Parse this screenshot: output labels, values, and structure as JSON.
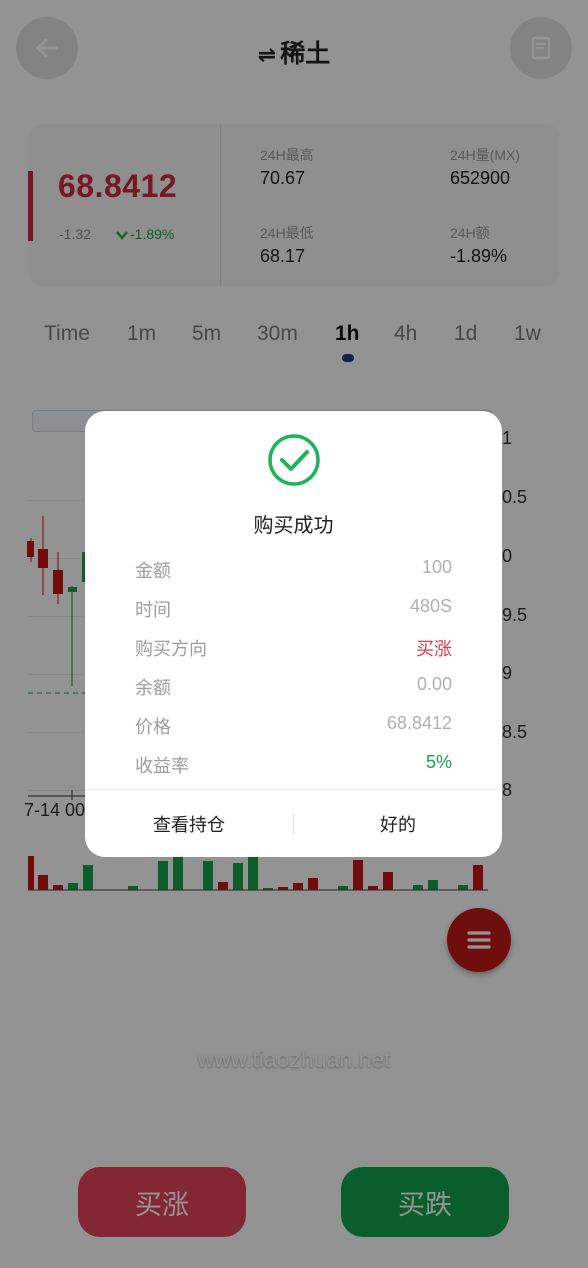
{
  "header": {
    "title": "稀土",
    "swap_glyph": "⇌",
    "back_icon": "arrow-left-icon",
    "doc_icon": "document-icon"
  },
  "ticker": {
    "price": "68.8412",
    "change": "-1.32",
    "change_pct": "-1.89%",
    "stats": [
      {
        "label": "24H最高",
        "value": "70.67"
      },
      {
        "label": "24H量(MX)",
        "value": "652900"
      },
      {
        "label": "24H最低",
        "value": "68.17"
      },
      {
        "label": "24H额",
        "value": "-1.89%"
      }
    ]
  },
  "intervals": [
    "Time",
    "1m",
    "5m",
    "30m",
    "1h",
    "4h",
    "1d",
    "1w"
  ],
  "active_interval": "1h",
  "chart": {
    "y_labels": [
      "1",
      "0.5",
      "0",
      "9.5",
      "9",
      "8.5",
      "8"
    ],
    "x_label": "7-14 00"
  },
  "watermark": "www.tiaozhuan.net",
  "buttons": {
    "buy_up": "买涨",
    "buy_down": "买跌"
  },
  "modal": {
    "title": "购买成功",
    "rows": [
      {
        "label": "金额",
        "value": "100"
      },
      {
        "label": "时间",
        "value": "480S"
      },
      {
        "label": "购买方向",
        "value": "买涨"
      },
      {
        "label": "余额",
        "value": "0.00"
      },
      {
        "label": "价格",
        "value": "68.8412"
      },
      {
        "label": "收益率",
        "value": "5%"
      }
    ],
    "view_positions": "查看持仓",
    "ok": "好的"
  },
  "colors": {
    "up_red": "#e0394f",
    "down_green": "#16a34a",
    "accent_blue": "#1f3f8f"
  }
}
